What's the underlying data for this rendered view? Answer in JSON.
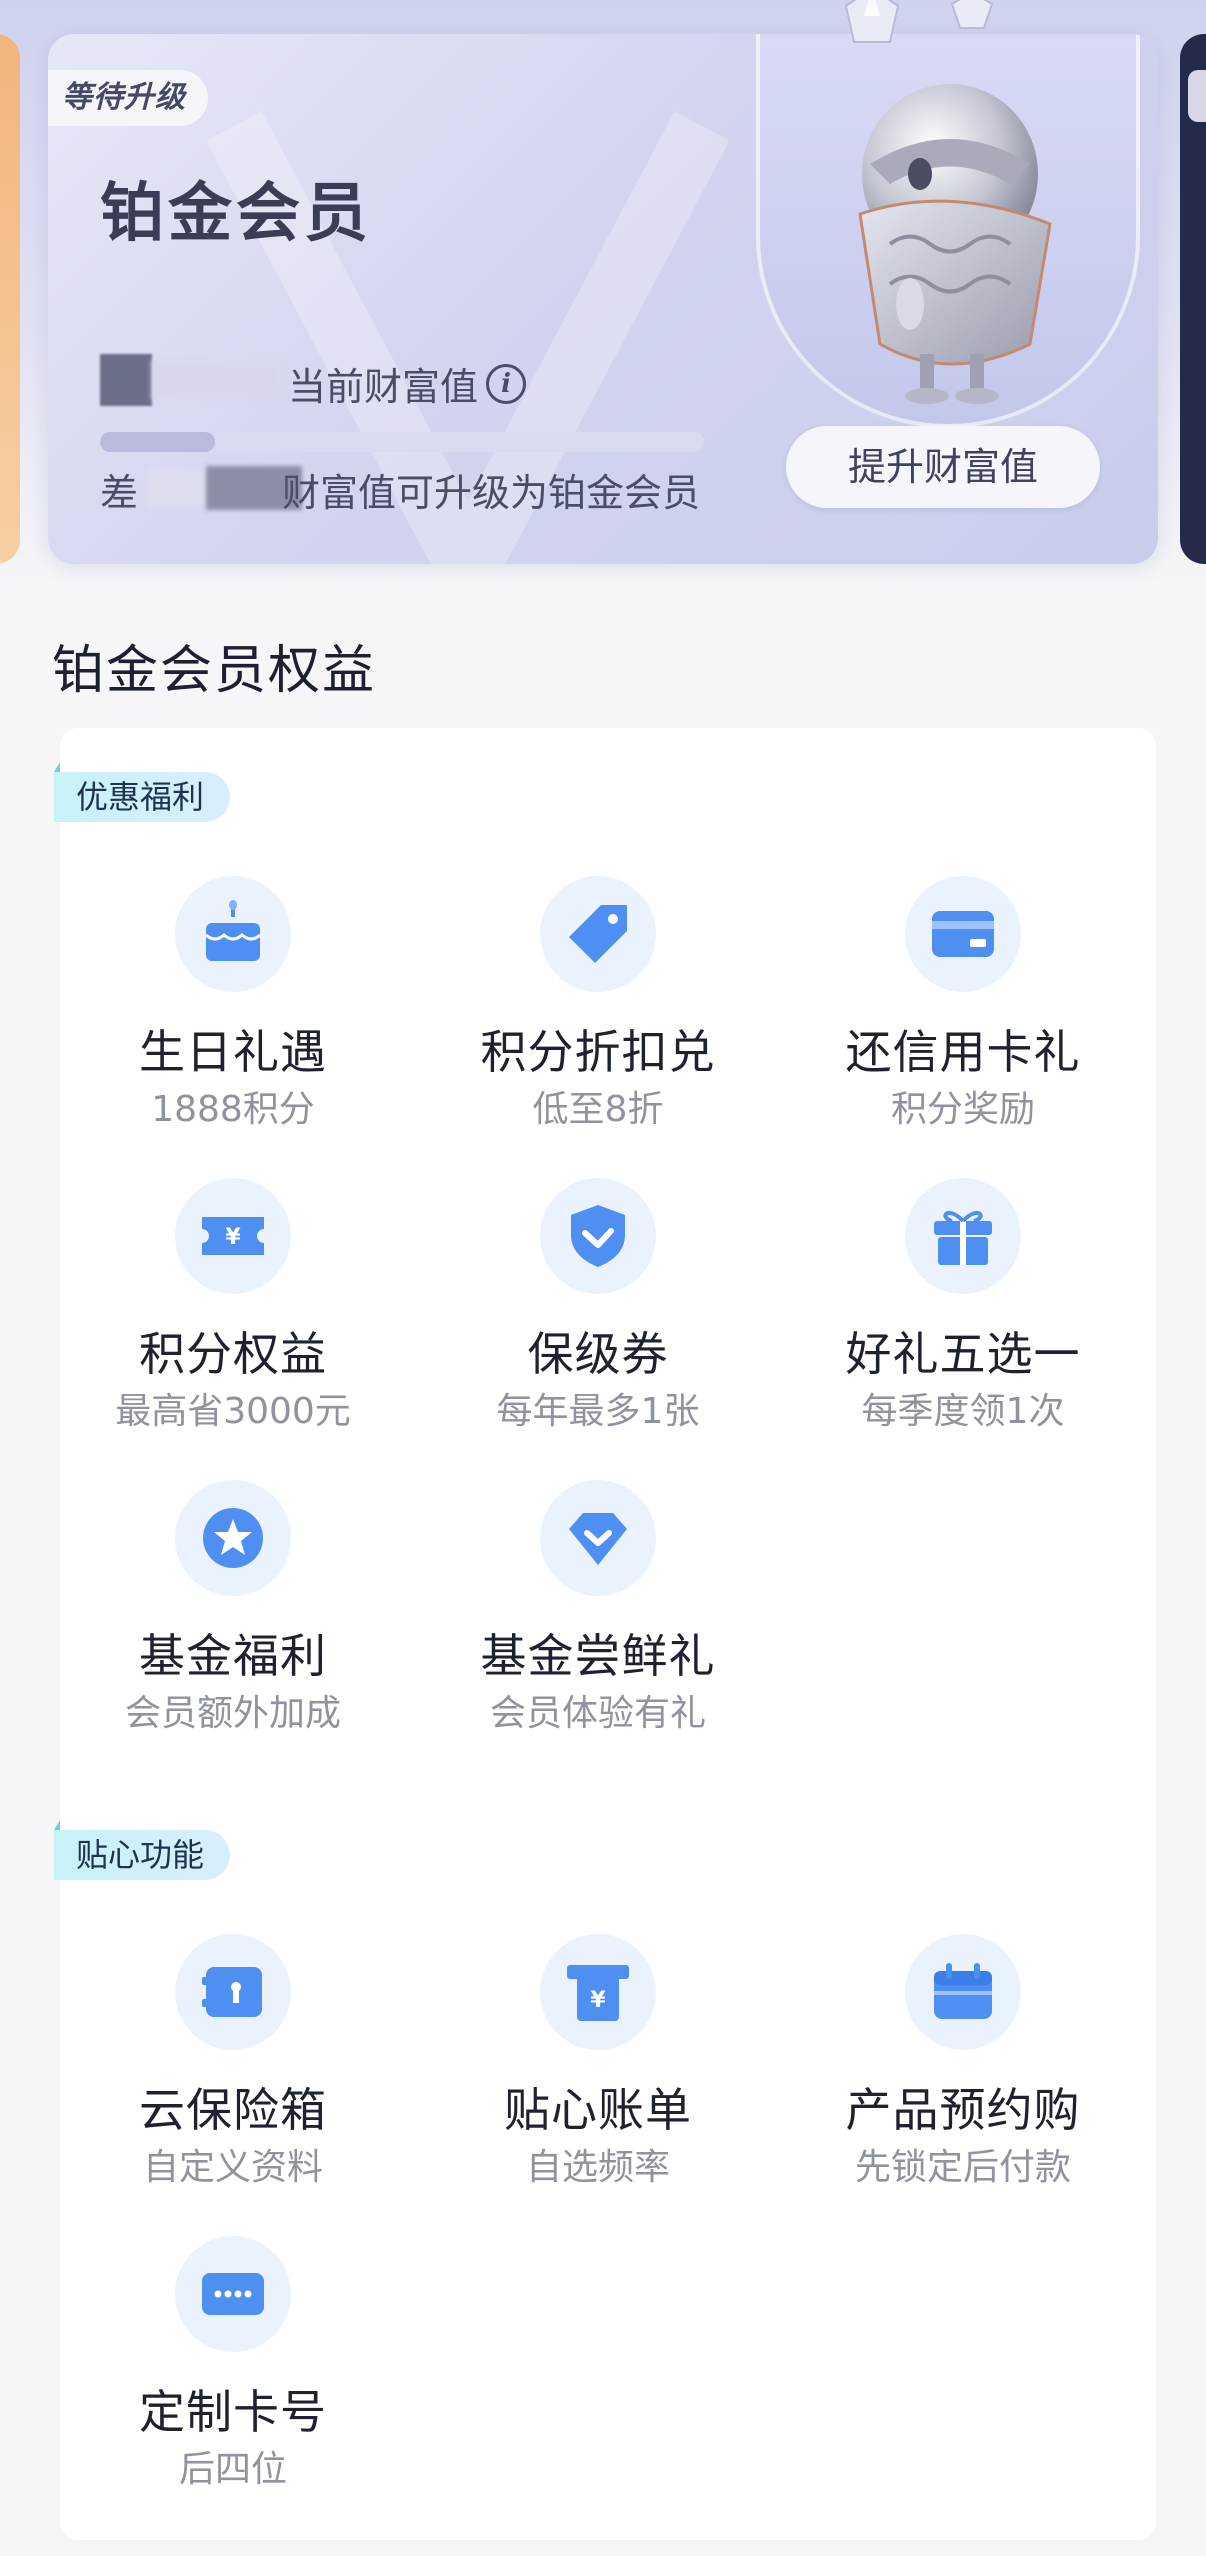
{
  "card": {
    "status_badge": "等待升级",
    "title": "铂金会员",
    "wealth_label": "当前财富值",
    "progress_fraction": 0.19,
    "diff_prefix": "差",
    "diff_suffix": "财富值可升级为铂金会员",
    "upgrade_button": "提升财富值"
  },
  "benefits": {
    "heading": "铂金会员权益",
    "groups": [
      {
        "tag": "优惠福利",
        "items": [
          {
            "title": "生日礼遇",
            "subtitle": "1888积分",
            "icon": "birthday-cake-icon"
          },
          {
            "title": "积分折扣兑",
            "subtitle": "低至8折",
            "icon": "price-tag-icon"
          },
          {
            "title": "还信用卡礼",
            "subtitle": "积分奖励",
            "icon": "credit-card-icon"
          },
          {
            "title": "积分权益",
            "subtitle": "最高省3000元",
            "icon": "yuan-ticket-icon"
          },
          {
            "title": "保级券",
            "subtitle": "每年最多1张",
            "icon": "shield-check-icon"
          },
          {
            "title": "好礼五选一",
            "subtitle": "每季度领1次",
            "icon": "gift-icon"
          },
          {
            "title": "基金福利",
            "subtitle": "会员额外加成",
            "icon": "star-badge-icon"
          },
          {
            "title": "基金尝鲜礼",
            "subtitle": "会员体验有礼",
            "icon": "diamond-icon"
          }
        ]
      },
      {
        "tag": "贴心功能",
        "items": [
          {
            "title": "云保险箱",
            "subtitle": "自定义资料",
            "icon": "safe-box-icon"
          },
          {
            "title": "贴心账单",
            "subtitle": "自选频率",
            "icon": "bill-icon"
          },
          {
            "title": "产品预约购",
            "subtitle": "先锁定后付款",
            "icon": "calendar-icon"
          },
          {
            "title": "定制卡号",
            "subtitle": "后四位",
            "icon": "card-number-icon"
          }
        ]
      }
    ]
  },
  "colors": {
    "accent_blue": "#4f8ff2",
    "icon_bg": "#eaf3fd",
    "title_dark": "#3a3d55"
  }
}
